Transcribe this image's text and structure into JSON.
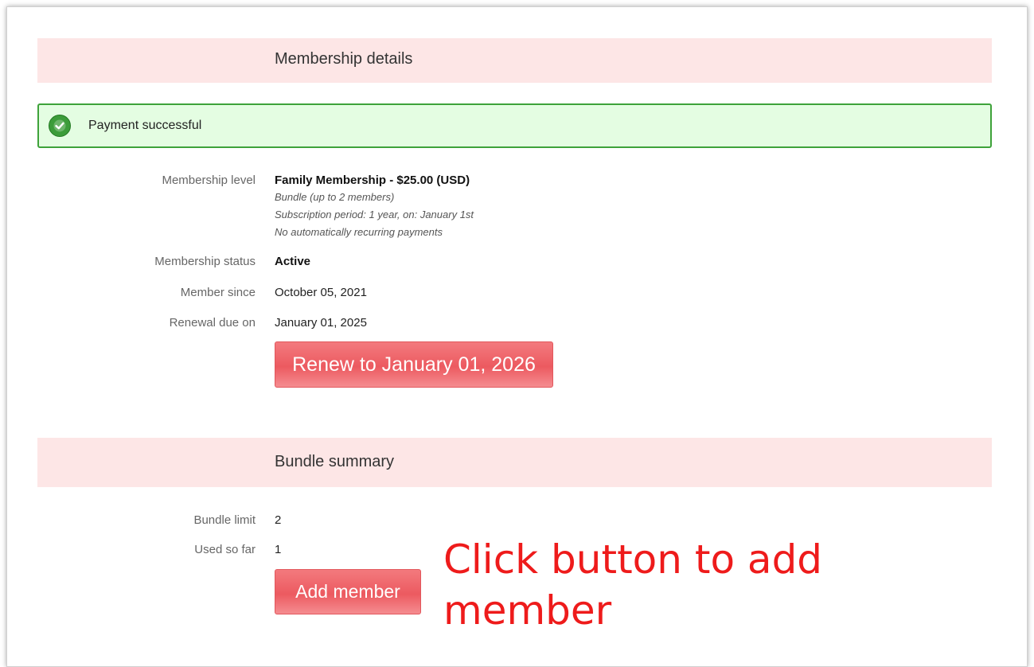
{
  "membership_details": {
    "header": "Membership details",
    "alert": {
      "message": "Payment successful",
      "icon": "check-circle-icon",
      "color": "#3c9c3a"
    },
    "level": {
      "label": "Membership level",
      "name": "Family Membership - $25.00 (USD)",
      "bundle": "Bundle (up to 2 members)",
      "period": "Subscription period: 1 year, on: January 1st",
      "recurring": "No automatically recurring payments"
    },
    "status": {
      "label": "Membership status",
      "value": "Active"
    },
    "member_since": {
      "label": "Member since",
      "value": "October 05, 2021"
    },
    "renewal_due": {
      "label": "Renewal due on",
      "value": "January 01, 2025"
    },
    "renew_button": "Renew to January 01, 2026"
  },
  "bundle_summary": {
    "header": "Bundle summary",
    "limit": {
      "label": "Bundle limit",
      "value": "2"
    },
    "used": {
      "label": "Used so far",
      "value": "1"
    },
    "add_button": "Add member"
  },
  "annotation": "Click button to add member",
  "colors": {
    "header_bg": "#fde6e6",
    "alert_bg": "#e4fde2",
    "alert_border": "#3ea23a",
    "button_bg": "#ec5a60",
    "annotation": "#ee1b1b"
  }
}
